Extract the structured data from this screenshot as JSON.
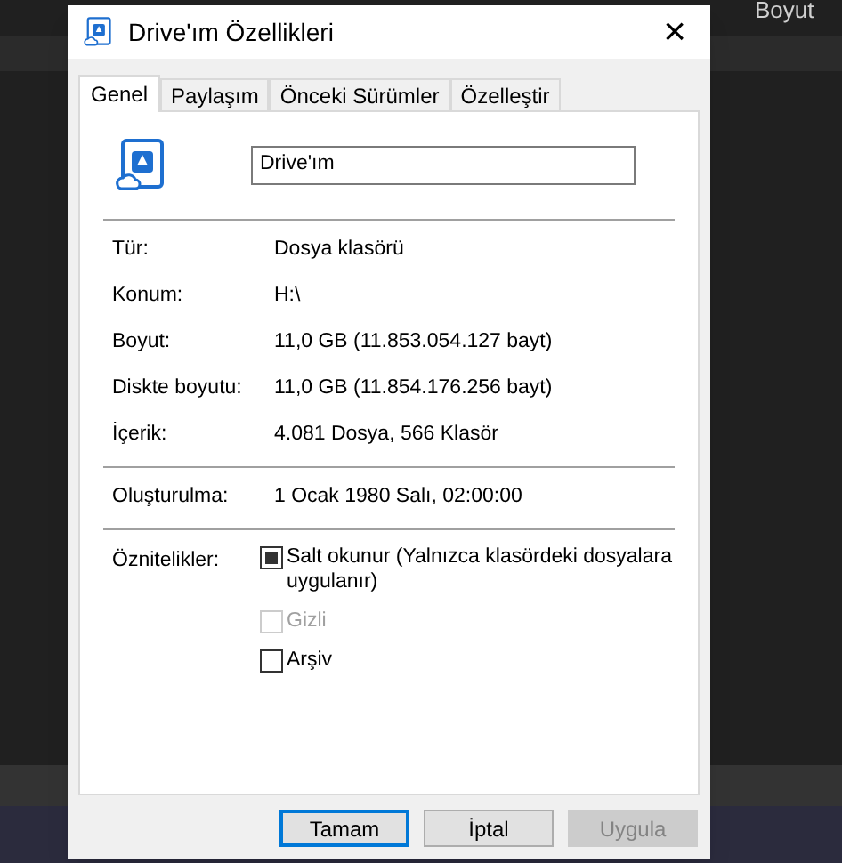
{
  "background": {
    "column_header": "Boyut"
  },
  "window": {
    "title": "Drive'ım Özellikleri",
    "close": "×"
  },
  "tabs": [
    {
      "label": "Genel",
      "selected": true
    },
    {
      "label": "Paylaşım",
      "selected": false
    },
    {
      "label": "Önceki Sürümler",
      "selected": false
    },
    {
      "label": "Özelleştir",
      "selected": false
    }
  ],
  "name_field": {
    "value": "Drive'ım"
  },
  "groups": [
    [
      {
        "label": "Tür:",
        "value": "Dosya klasörü"
      },
      {
        "label": "Konum:",
        "value": "H:\\"
      },
      {
        "label": "Boyut:",
        "value": "11,0 GB (11.853.054.127 bayt)"
      },
      {
        "label": "Diskte boyutu:",
        "value": "11,0 GB (11.854.176.256 bayt)"
      },
      {
        "label": "İçerik:",
        "value": "4.081 Dosya, 566 Klasör"
      }
    ],
    [
      {
        "label": "Oluşturulma:",
        "value": "1 Ocak 1980 Salı, 02:00:00"
      }
    ]
  ],
  "attributes": {
    "label": "Öznitelikler:",
    "items": [
      {
        "label": "Salt okunur (Yalnızca klasördeki dosyalara uygulanır)",
        "checked": false,
        "indeterminate": true,
        "disabled": false
      },
      {
        "label": "Gizli",
        "checked": false,
        "indeterminate": false,
        "disabled": true
      },
      {
        "label": "Arşiv",
        "checked": false,
        "indeterminate": false,
        "disabled": false
      }
    ]
  },
  "buttons": [
    {
      "label": "Tamam",
      "default": true,
      "disabled": false
    },
    {
      "label": "İptal",
      "default": false,
      "disabled": false
    },
    {
      "label": "Uygula",
      "default": false,
      "disabled": true
    }
  ]
}
